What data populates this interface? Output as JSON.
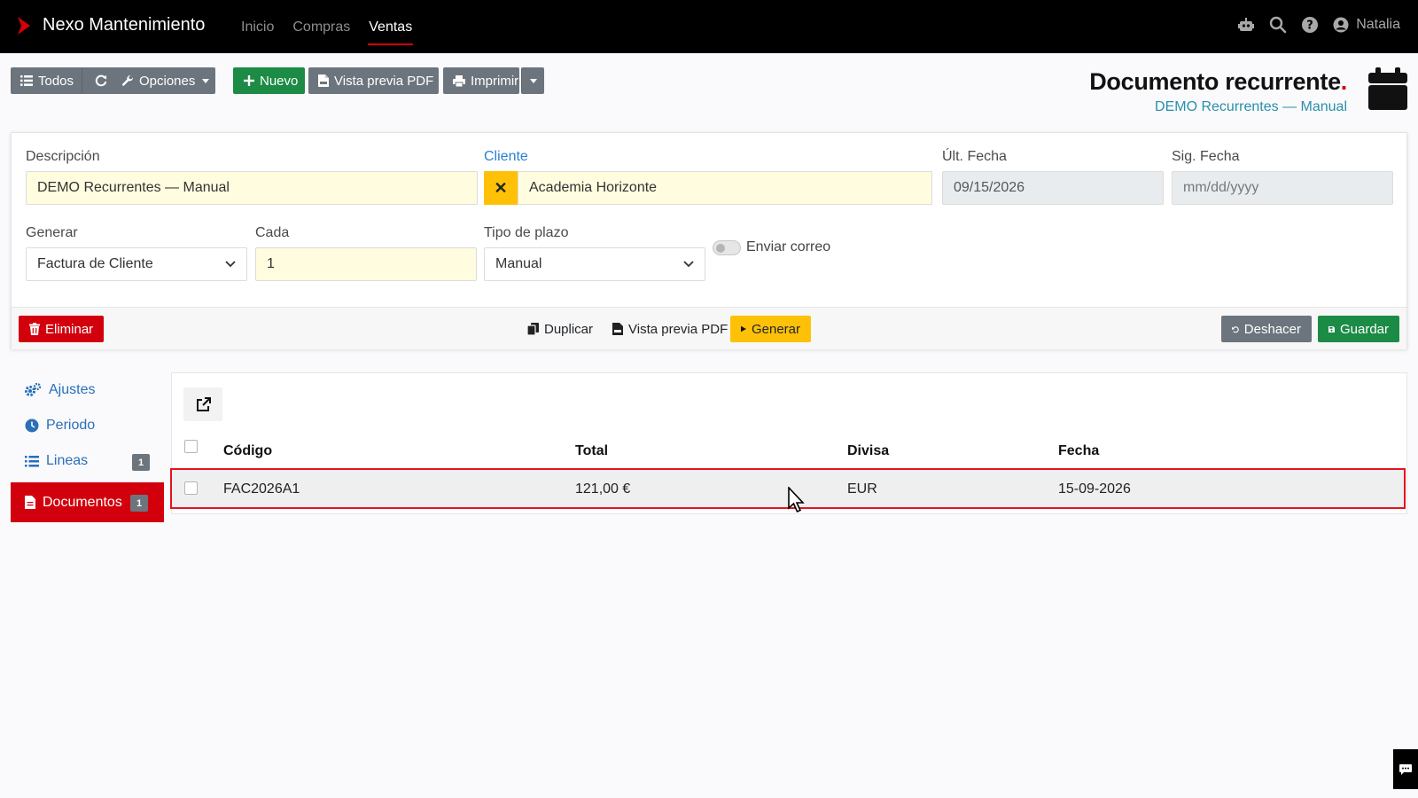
{
  "app": {
    "brand": "Nexo Mantenimiento",
    "nav": [
      "Inicio",
      "Compras",
      "Ventas"
    ],
    "user": "Natalia"
  },
  "toolbar": {
    "todos": "Todos",
    "opciones": "Opciones",
    "nuevo": "Nuevo",
    "vista_previa": "Vista previa PDF",
    "imprimir": "Imprimir"
  },
  "header": {
    "title": "Documento recurrente",
    "title_dot": ".",
    "subtitle": "DEMO Recurrentes — Manual"
  },
  "form": {
    "descripcion_label": "Descripción",
    "descripcion_value": "DEMO Recurrentes — Manual",
    "cliente_label": "Cliente",
    "cliente_value": "Academia Horizonte",
    "ult_fecha_label": "Últ. Fecha",
    "ult_fecha_value": "09/15/2026",
    "sig_fecha_label": "Sig. Fecha",
    "sig_fecha_placeholder": "mm/dd/yyyy",
    "generar_label": "Generar",
    "generar_value": "Factura de Cliente",
    "cada_label": "Cada",
    "cada_value": "1",
    "tipo_plazo_label": "Tipo de plazo",
    "tipo_plazo_value": "Manual",
    "enviar_correo_label": "Enviar correo",
    "enviar_correo_on": false
  },
  "footer": {
    "eliminar": "Eliminar",
    "duplicar": "Duplicar",
    "vista_previa": "Vista previa PDF",
    "generar": "Generar",
    "deshacer": "Deshacer",
    "guardar": "Guardar"
  },
  "side": {
    "items": [
      {
        "label": "Ajustes"
      },
      {
        "label": "Periodo"
      },
      {
        "label": "Lineas",
        "badge": "1"
      },
      {
        "label": "Documentos",
        "badge": "1"
      }
    ]
  },
  "table": {
    "columns": [
      "Código",
      "Total",
      "Divisa",
      "Fecha"
    ],
    "rows": [
      {
        "codigo": "FAC2026A1",
        "total": "121,00 €",
        "divisa": "EUR",
        "fecha": "15-09-2026"
      }
    ]
  },
  "colors": {
    "accent": "#d2000c",
    "success": "#1c8b45",
    "warning": "#ffc107",
    "secondary": "#6c757d"
  }
}
